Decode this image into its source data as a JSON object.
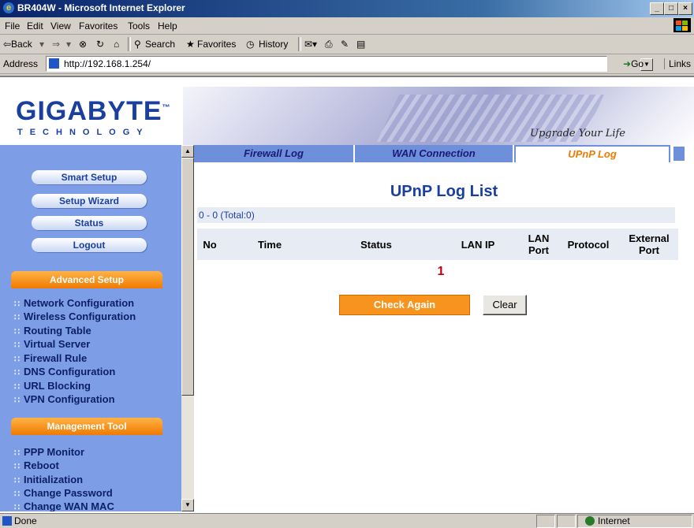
{
  "window": {
    "title": "BR404W - Microsoft Internet Explorer"
  },
  "menu": {
    "items": [
      "File",
      "Edit",
      "View",
      "Favorites",
      "Tools",
      "Help"
    ]
  },
  "toolbar": {
    "back": "⇦Back",
    "search": "Search",
    "favorites": "Favorites",
    "history": "History"
  },
  "address": {
    "label": "Address",
    "url": "http://192.168.1.254/",
    "go": "Go",
    "links": "Links"
  },
  "logo": {
    "brand": "GIGABYTE",
    "sub": "TECHNOLOGY",
    "trademark": "™"
  },
  "banner": {
    "slogan": "Upgrade Your Life"
  },
  "leftnav": {
    "buttons": [
      "Smart Setup",
      "Setup Wizard",
      "Status",
      "Logout"
    ],
    "advanced_header": "Advanced Setup",
    "advanced_items": [
      "Network Configuration",
      "Wireless Configuration",
      "Routing Table",
      "Virtual Server",
      "Firewall Rule",
      "DNS Configuration",
      "URL Blocking",
      "VPN Configuration"
    ],
    "management_header": "Management Tool",
    "management_items": [
      "PPP Monitor",
      "Reboot",
      "Initialization",
      "Change Password",
      "Change WAN MAC"
    ]
  },
  "tabs": [
    {
      "label": "Firewall Log",
      "active": false
    },
    {
      "label": "WAN Connection",
      "active": false
    },
    {
      "label": "UPnP Log",
      "active": true
    }
  ],
  "main": {
    "title": "UPnP Log List",
    "range": "0 - 0 (Total:0)",
    "columns": [
      "No",
      "Time",
      "Status",
      "LAN IP",
      "LAN Port",
      "Protocol",
      "External Port"
    ],
    "page_number": "1",
    "check_again": "Check Again",
    "clear": "Clear"
  },
  "status": {
    "text": "Done",
    "zone": "Internet"
  },
  "colors": {
    "nav_bg": "#7d9ee6",
    "accent_orange": "#f7941d",
    "brand_blue": "#1a3f9e",
    "page_number": "#c0000a"
  }
}
